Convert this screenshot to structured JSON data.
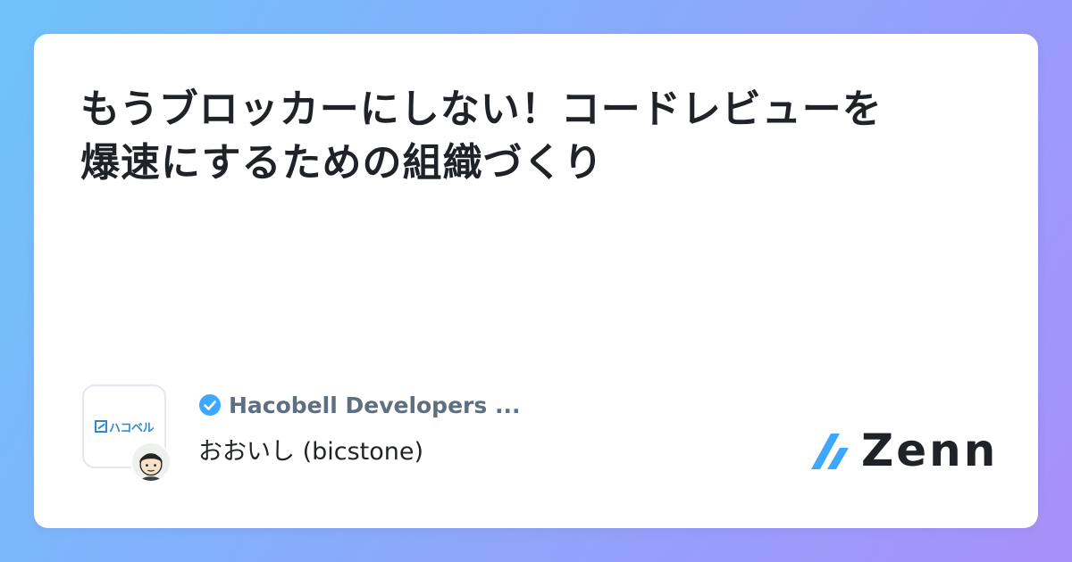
{
  "article": {
    "title": "もうブロッカーにしない！コードレビューを爆速にするための組織づくり"
  },
  "publication": {
    "name": "Hacobell Developers ...",
    "logo_text": "ハコベル",
    "verified": true,
    "icon": "verified-check-icon"
  },
  "author": {
    "display": "おおいし (bicstone)"
  },
  "brand": {
    "name": "Zenn",
    "icon": "zenn-logo-icon"
  },
  "colors": {
    "background_start": "#6fc3fb",
    "background_end": "#a890f7",
    "card": "#ffffff",
    "title_text": "#1f2328",
    "publication_text": "#5f6e80",
    "accent": "#3ea8ff"
  }
}
